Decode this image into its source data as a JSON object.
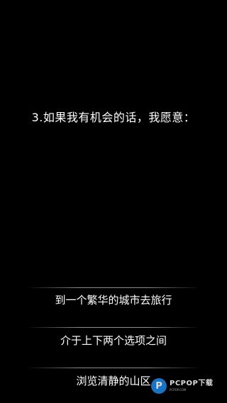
{
  "question": {
    "text": "3.如果我有机会的话，我愿意："
  },
  "options": [
    {
      "label": "到一个繁华的城市去旅行"
    },
    {
      "label": "介于上下两个选项之间"
    },
    {
      "label": "浏览清静的山区"
    }
  ],
  "watermark": {
    "logo_letter": "P",
    "text": "PCPOP下载",
    "subtext": "PCPOP.COM"
  },
  "colors": {
    "background": "#000000",
    "text": "#ffffff",
    "watermark_logo": "#1e88e5"
  }
}
